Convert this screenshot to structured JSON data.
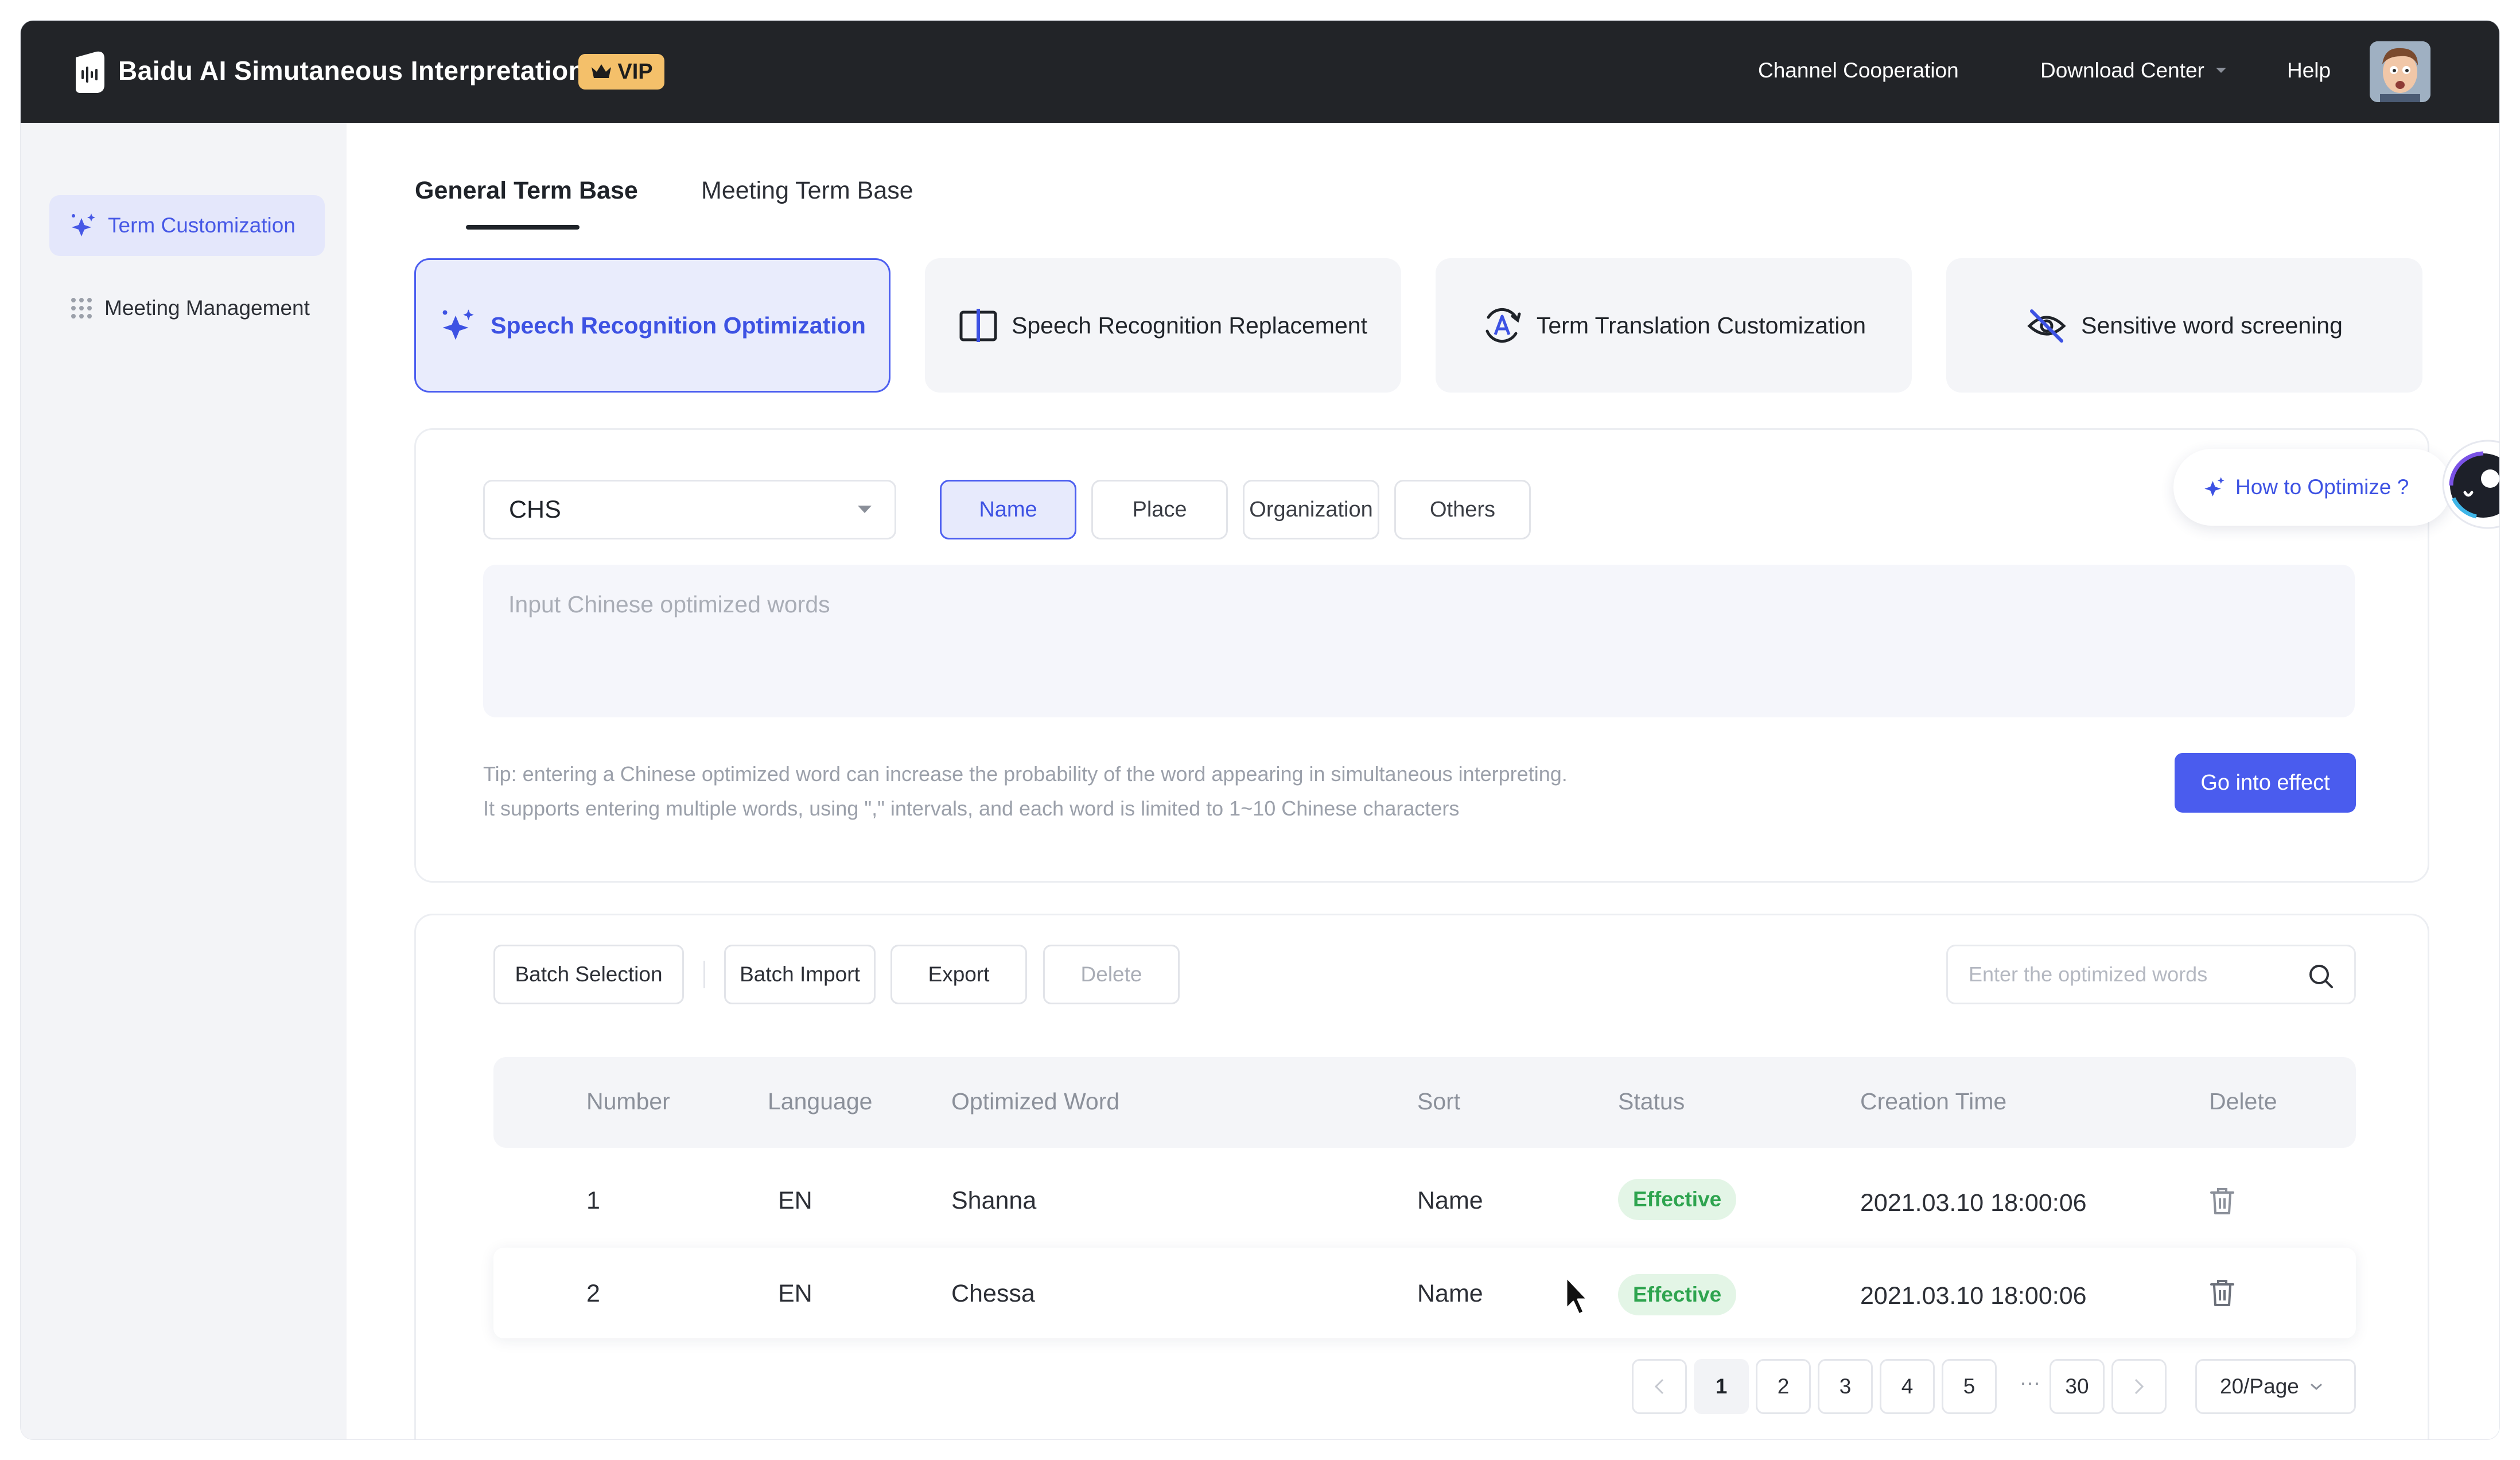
{
  "header": {
    "app_title": "Baidu AI Simutaneous Interpretation",
    "vip_label": "VIP",
    "nav": {
      "channel": "Channel Cooperation",
      "download": "Download Center",
      "help": "Help"
    }
  },
  "sidebar": {
    "items": [
      {
        "label": "Term Customization",
        "icon": "sparkle-icon",
        "active": true
      },
      {
        "label": "Meeting Management",
        "icon": "grid-icon",
        "active": false
      }
    ]
  },
  "tabs": [
    {
      "label": "General Term Base",
      "active": true
    },
    {
      "label": "Meeting Term Base",
      "active": false
    }
  ],
  "cards": [
    {
      "label": "Speech Recognition Optimization",
      "icon": "sparkle-icon",
      "active": true
    },
    {
      "label": "Speech Recognition Replacement",
      "icon": "swap-panel-icon",
      "active": false
    },
    {
      "label": "Term Translation Customization",
      "icon": "translate-icon",
      "active": false
    },
    {
      "label": "Sensitive word screening",
      "icon": "eye-off-icon",
      "active": false
    }
  ],
  "form": {
    "language": "CHS",
    "categories": [
      "Name",
      "Place",
      "Organization",
      "Others"
    ],
    "active_category": "Name",
    "input_placeholder": "Input Chinese optimized words",
    "tip_line1": "Tip: entering a Chinese optimized word can increase the probability of the word appearing in simultaneous interpreting.",
    "tip_line2": "It supports entering multiple words, using \",\" intervals, and each word is limited to 1~10 Chinese characters",
    "submit_label": "Go into effect",
    "help_label": "How to Optimize ?"
  },
  "toolbar": {
    "batch_selection": "Batch Selection",
    "batch_import": "Batch Import",
    "export": "Export",
    "delete": "Delete",
    "search_placeholder": "Enter the optimized words"
  },
  "table": {
    "columns": [
      "Number",
      "Language",
      "Optimized Word",
      "Sort",
      "Status",
      "Creation Time",
      "Delete"
    ],
    "rows": [
      {
        "number": "1",
        "language": "EN",
        "word": "Shanna",
        "sort": "Name",
        "status": "Effective",
        "time": "2021.03.10 18:00:06"
      },
      {
        "number": "2",
        "language": "EN",
        "word": "Chessa",
        "sort": "Name",
        "status": "Effective",
        "time": "2021.03.10 18:00:06"
      }
    ]
  },
  "pagination": {
    "pages": [
      "1",
      "2",
      "3",
      "4",
      "5"
    ],
    "ellipsis": "···",
    "last_page": "30",
    "current": "1",
    "per_page": "20/Page"
  },
  "colors": {
    "accent": "#4a5cee",
    "header_bg": "#222428",
    "vip": "#f4c06a",
    "effective": "#2ea44f"
  }
}
